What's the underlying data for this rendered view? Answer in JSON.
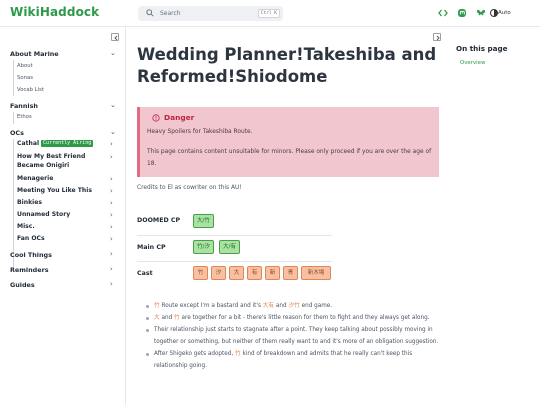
{
  "header": {
    "site_name": "WikiHaddock",
    "search_placeholder": "Search",
    "search_shortcut": "Ctrl K",
    "theme_label": "Auto",
    "icons": [
      "code-icon",
      "mastodon-icon",
      "bluesky-icon",
      "theme-icon"
    ]
  },
  "sidebar": {
    "sections": [
      {
        "label": "About Marine",
        "children": [
          "About",
          "Sonas",
          "Vocab List"
        ]
      },
      {
        "label": "Fannish",
        "children": [
          "Ethos"
        ]
      },
      {
        "label": "OCs",
        "children": []
      }
    ],
    "oc_items": [
      {
        "label": "Cathal",
        "badge": "Currently Airing"
      },
      {
        "label": "How My Best Friend Became Onigiri"
      },
      {
        "label": "Menagerie"
      },
      {
        "label": "Meeting You Like This"
      },
      {
        "label": "Binkies"
      },
      {
        "label": "Unnamed Story"
      },
      {
        "label": "Misc."
      },
      {
        "label": "Fan OCs"
      }
    ],
    "bottom_sections": [
      "Cool Things",
      "Reminders",
      "Guides"
    ]
  },
  "toc": {
    "title": "On this page",
    "items": [
      "Overview"
    ]
  },
  "main": {
    "title": "Wedding Planner!Takeshiba and Reformed!Shiodome",
    "danger": {
      "title": "Danger",
      "line1": "Heavy Spoilers for Takeshiba Route.",
      "line2": "This page contains content unsuitable for minors. Please only proceed if you are over the age of 18."
    },
    "credits": "Credits to El as cowriter on this AU!",
    "rows": [
      {
        "label": "DOOMED CP",
        "tags": [
          "大/竹"
        ],
        "color": "green"
      },
      {
        "label": "Main CP",
        "tags": [
          "竹/汐",
          "大/有"
        ],
        "color": "green"
      },
      {
        "label": "Cast",
        "tags": [
          "竹",
          "汐",
          "大",
          "有",
          "新",
          "青",
          "新木場"
        ],
        "color": "orange"
      }
    ],
    "bullets": [
      {
        "parts": [
          [
            "竹",
            "hl"
          ],
          [
            " Route except I'm a bastard and it's ",
            ""
          ],
          [
            "大有",
            "hl"
          ],
          [
            " and ",
            ""
          ],
          [
            "汐竹",
            "hl"
          ],
          [
            " end game.",
            ""
          ]
        ]
      },
      {
        "parts": [
          [
            "大",
            "hl"
          ],
          [
            " and ",
            ""
          ],
          [
            "竹",
            "hl"
          ],
          [
            " are together for a bit - there's little reason for them to fight and they always get along.",
            ""
          ]
        ]
      },
      {
        "parts": [
          [
            "Their relationship just starts to stagnate after a point. They keep talking about possibly moving in together or something, but neither of them really want to and it's more of an obligation suggestion.",
            ""
          ]
        ]
      },
      {
        "parts": [
          [
            "After Shigeko gets adopted, ",
            ""
          ],
          [
            "竹",
            "hl"
          ],
          [
            " kind of breakdown and admits that he really can't keep this relationship going.",
            ""
          ]
        ]
      }
    ]
  },
  "colors": {
    "brand": "#2e9a49",
    "danger_bg": "#f2c6cf",
    "danger_title": "#c0233f",
    "tag_green": "#a9e3a2",
    "tag_orange": "#f8c0a0"
  }
}
